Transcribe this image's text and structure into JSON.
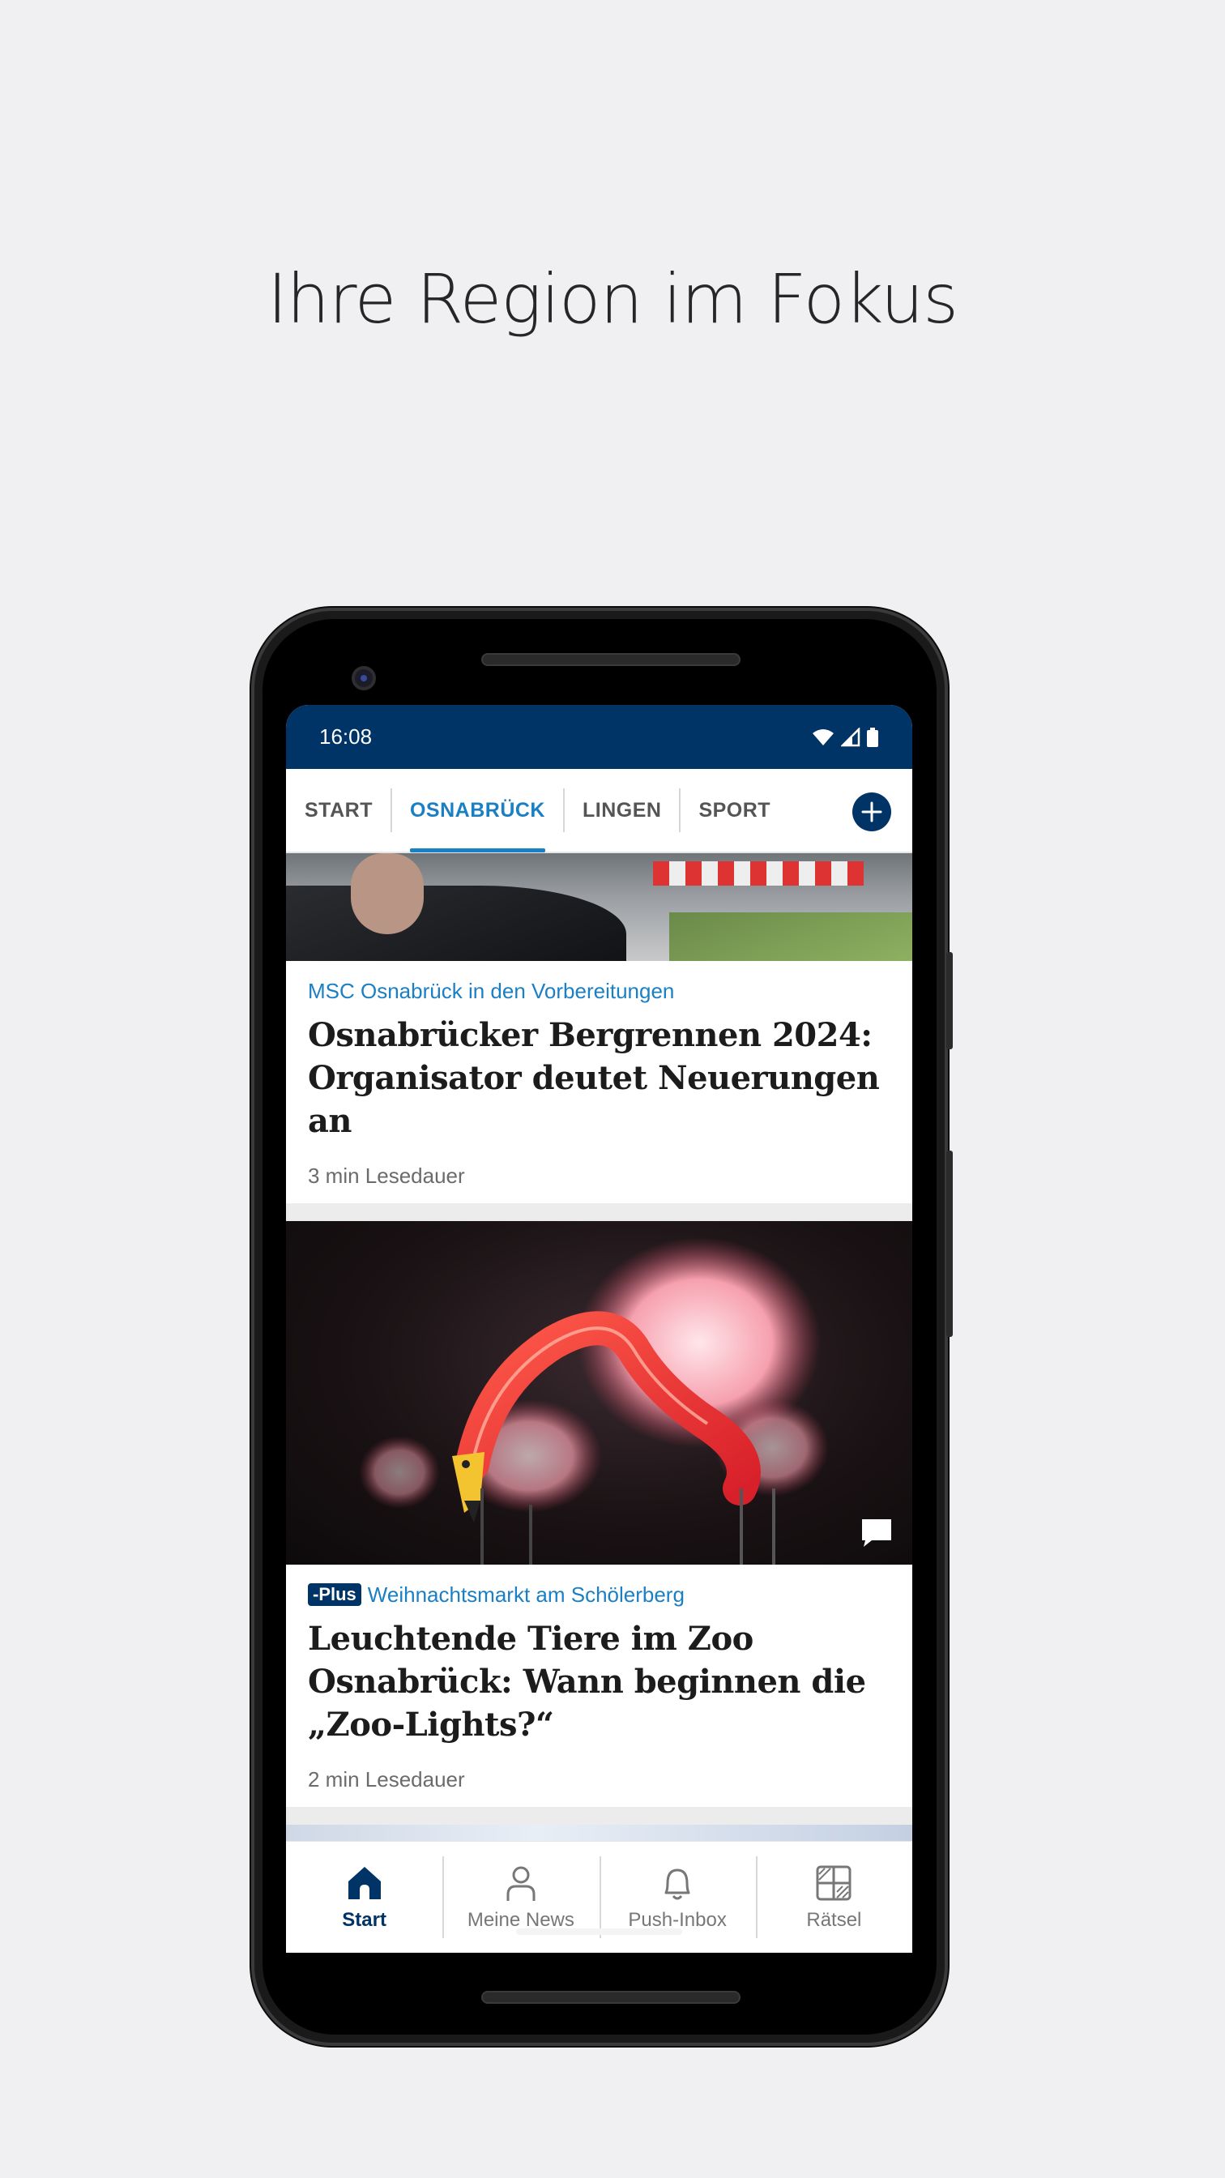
{
  "headline": "Ihre Region im Fokus",
  "statusbar": {
    "time": "16:08"
  },
  "tabs": [
    {
      "label": "START",
      "active": false
    },
    {
      "label": "OSNABRÜCK",
      "active": true
    },
    {
      "label": "LINGEN",
      "active": false
    },
    {
      "label": "SPORT",
      "active": false
    }
  ],
  "articles": [
    {
      "kicker": "MSC Osnabrück in den Vorbereitungen",
      "title_line1": "Osnabrücker Bergrennen 2024:",
      "title_line2": "Organisator deutet Neuerungen an",
      "meta": "3 min Lesedauer"
    },
    {
      "badge": "Plus",
      "kicker": "Weihnachtsmarkt am Schölerberg",
      "title_line1": "Leuchtende Tiere im Zoo",
      "title_line2": "Osnabrück: Wann beginnen die",
      "title_line3": "„Zoo-Lights?“",
      "meta": "2 min Lesedauer"
    }
  ],
  "bottom_nav": [
    {
      "label": "Start",
      "icon": "home-icon",
      "active": true
    },
    {
      "label": "Meine News",
      "icon": "person-icon",
      "active": false
    },
    {
      "label": "Push-Inbox",
      "icon": "bell-icon",
      "active": false
    },
    {
      "label": "Rätsel",
      "icon": "puzzle-icon",
      "active": false
    }
  ],
  "colors": {
    "brand_navy": "#003366",
    "accent_blue": "#1b7fc4",
    "background": "#f0f0f2"
  }
}
